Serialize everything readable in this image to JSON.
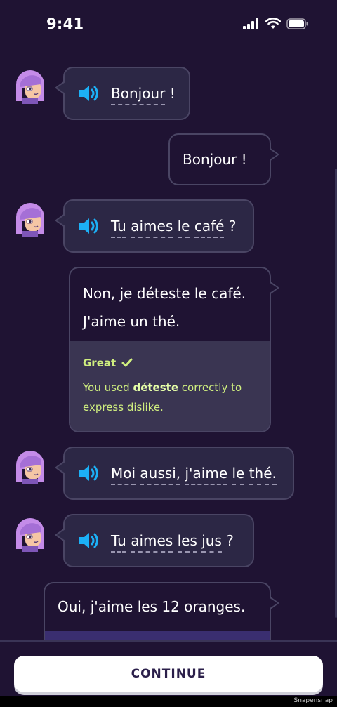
{
  "status_bar": {
    "time": "9:41"
  },
  "colors": {
    "background": "#1f1333",
    "bubble": "#2c2745",
    "border": "#4a4564",
    "accent": "#1cb0f6",
    "feedback": "#cfee7f"
  },
  "messages": [
    {
      "speaker": "character",
      "words": [
        "Bonjour",
        "!"
      ]
    },
    {
      "speaker": "user",
      "text": "Bonjour !"
    },
    {
      "speaker": "character",
      "words": [
        "Tu",
        "aimes",
        "le",
        "café",
        "?"
      ]
    },
    {
      "speaker": "user_response",
      "lines": [
        "Non, je déteste le café.",
        "J'aime un thé."
      ],
      "feedback": {
        "title": "Great",
        "body_before": "You used ",
        "body_bold": "déteste",
        "body_after": " correctly to",
        "body_line2": "express dislike."
      }
    },
    {
      "speaker": "character",
      "words": [
        "Moi",
        "aussi,",
        "j'aime",
        "le",
        "thé."
      ]
    },
    {
      "speaker": "character",
      "words": [
        "Tu",
        "aimes",
        "les",
        "jus",
        "?"
      ]
    },
    {
      "speaker": "user",
      "text": "Oui, j'aime les 12 oranges."
    }
  ],
  "continue_label": "CONTINUE",
  "watermark": "Snapensnap",
  "icons": {
    "speaker": "speaker-icon",
    "check": "check-icon",
    "signal": "signal-icon",
    "wifi": "wifi-icon",
    "battery": "battery-icon"
  }
}
